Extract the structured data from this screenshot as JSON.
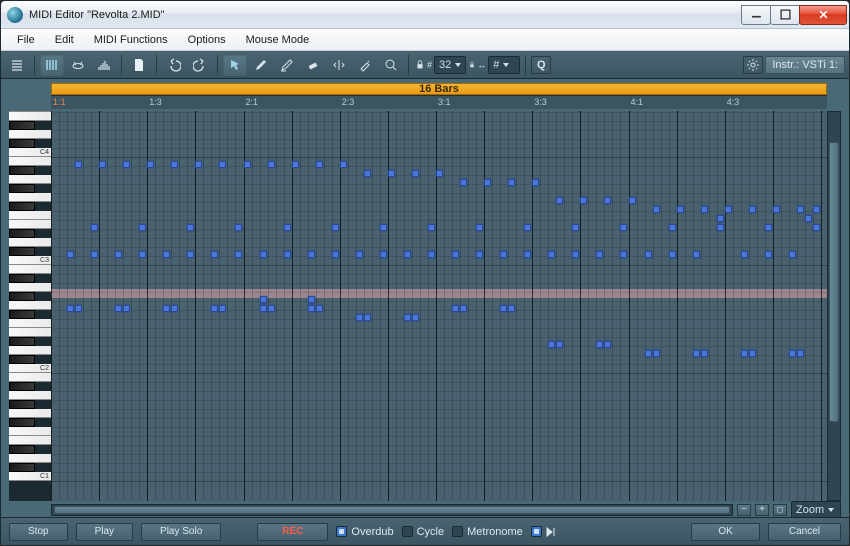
{
  "window": {
    "title": "MIDI Editor \"Revolta 2.MID\""
  },
  "menus": [
    "File",
    "Edit",
    "MIDI Functions",
    "Options",
    "Mouse Mode"
  ],
  "toolbar": {
    "snap_value": "32",
    "snap_len": "#",
    "instr_label": "Instr.: VSTi 1:"
  },
  "loop": {
    "label": "16 Bars"
  },
  "ruler": {
    "ticks": [
      "1:1",
      "1:3",
      "2:1",
      "2:3",
      "3:1",
      "3:3",
      "4:1",
      "4:3"
    ]
  },
  "keyboard": {
    "octave_labels": [
      "C1",
      "C2",
      "C3",
      "C4"
    ]
  },
  "footer": {
    "stop": "Stop",
    "play": "Play",
    "playsolo": "Play Solo",
    "rec": "REC",
    "overdub": "Overdub",
    "cycle": "Cycle",
    "metronome": "Metronome",
    "ok": "OK",
    "cancel": "Cancel"
  },
  "zoom": {
    "label": "Zoom"
  },
  "notes": [
    {
      "x": 2,
      "r": 10
    },
    {
      "x": 3,
      "r": 20
    },
    {
      "x": 5,
      "r": 10
    },
    {
      "x": 6,
      "r": 20
    },
    {
      "x": 8,
      "r": 10
    },
    {
      "x": 9,
      "r": 20
    },
    {
      "x": 11,
      "r": 10
    },
    {
      "x": 12,
      "r": 20
    },
    {
      "x": 14,
      "r": 10
    },
    {
      "x": 15,
      "r": 20
    },
    {
      "x": 17,
      "r": 10
    },
    {
      "x": 18,
      "r": 20
    },
    {
      "x": 20,
      "r": 10
    },
    {
      "x": 21,
      "r": 20
    },
    {
      "x": 23,
      "r": 10
    },
    {
      "x": 24,
      "r": 20
    },
    {
      "x": 26,
      "r": 10
    },
    {
      "x": 27,
      "r": 20
    },
    {
      "x": 29,
      "r": 10
    },
    {
      "x": 30,
      "r": 20
    },
    {
      "x": 32,
      "r": 10
    },
    {
      "x": 33,
      "r": 20
    },
    {
      "x": 35,
      "r": 10
    },
    {
      "x": 36,
      "r": 20
    },
    {
      "x": 38,
      "r": 10
    },
    {
      "x": 39,
      "r": 19
    },
    {
      "x": 41,
      "r": 10
    },
    {
      "x": 42,
      "r": 19
    },
    {
      "x": 44,
      "r": 10
    },
    {
      "x": 45,
      "r": 19
    },
    {
      "x": 47,
      "r": 10
    },
    {
      "x": 48,
      "r": 19
    },
    {
      "x": 50,
      "r": 10
    },
    {
      "x": 51,
      "r": 18
    },
    {
      "x": 53,
      "r": 10
    },
    {
      "x": 54,
      "r": 18
    },
    {
      "x": 56,
      "r": 10
    },
    {
      "x": 57,
      "r": 18
    },
    {
      "x": 59,
      "r": 10
    },
    {
      "x": 60,
      "r": 18
    },
    {
      "x": 62,
      "r": 10
    },
    {
      "x": 63,
      "r": 16
    },
    {
      "x": 65,
      "r": 10
    },
    {
      "x": 66,
      "r": 16
    },
    {
      "x": 68,
      "r": 10
    },
    {
      "x": 69,
      "r": 16
    },
    {
      "x": 71,
      "r": 10
    },
    {
      "x": 72,
      "r": 16
    },
    {
      "x": 74,
      "r": 10
    },
    {
      "x": 75,
      "r": 15
    },
    {
      "x": 77,
      "r": 10
    },
    {
      "x": 78,
      "r": 15
    },
    {
      "x": 80,
      "r": 10
    },
    {
      "x": 81,
      "r": 15
    },
    {
      "x": 83,
      "r": 14
    },
    {
      "x": 84,
      "r": 15
    },
    {
      "x": 86,
      "r": 10
    },
    {
      "x": 87,
      "r": 15
    },
    {
      "x": 89,
      "r": 10
    },
    {
      "x": 90,
      "r": 15
    },
    {
      "x": 92,
      "r": 10
    },
    {
      "x": 93,
      "r": 15
    },
    {
      "x": 94,
      "r": 14
    },
    {
      "x": 95,
      "r": 15
    },
    {
      "x": 2,
      "r": 4
    },
    {
      "x": 3,
      "r": 4
    },
    {
      "x": 8,
      "r": 4
    },
    {
      "x": 9,
      "r": 4
    },
    {
      "x": 14,
      "r": 4
    },
    {
      "x": 15,
      "r": 4
    },
    {
      "x": 20,
      "r": 4
    },
    {
      "x": 21,
      "r": 4
    },
    {
      "x": 26,
      "r": 4
    },
    {
      "x": 26,
      "r": 5
    },
    {
      "x": 27,
      "r": 4
    },
    {
      "x": 32,
      "r": 4
    },
    {
      "x": 32,
      "r": 5
    },
    {
      "x": 33,
      "r": 4
    },
    {
      "x": 38,
      "r": 3
    },
    {
      "x": 39,
      "r": 3
    },
    {
      "x": 44,
      "r": 3
    },
    {
      "x": 45,
      "r": 3
    },
    {
      "x": 50,
      "r": 4
    },
    {
      "x": 51,
      "r": 4
    },
    {
      "x": 56,
      "r": 4
    },
    {
      "x": 57,
      "r": 4
    },
    {
      "x": 62,
      "r": 0
    },
    {
      "x": 63,
      "r": 0
    },
    {
      "x": 68,
      "r": 0
    },
    {
      "x": 69,
      "r": 0
    },
    {
      "x": 74,
      "r": -1
    },
    {
      "x": 75,
      "r": -1
    },
    {
      "x": 80,
      "r": -1
    },
    {
      "x": 81,
      "r": -1
    },
    {
      "x": 86,
      "r": -1
    },
    {
      "x": 87,
      "r": -1
    },
    {
      "x": 92,
      "r": -1
    },
    {
      "x": 93,
      "r": -1
    },
    {
      "x": 5,
      "r": 13
    },
    {
      "x": 11,
      "r": 13
    },
    {
      "x": 17,
      "r": 13
    },
    {
      "x": 23,
      "r": 13
    },
    {
      "x": 29,
      "r": 13
    },
    {
      "x": 35,
      "r": 13
    },
    {
      "x": 41,
      "r": 13
    },
    {
      "x": 47,
      "r": 13
    },
    {
      "x": 53,
      "r": 13
    },
    {
      "x": 59,
      "r": 13
    },
    {
      "x": 65,
      "r": 13
    },
    {
      "x": 71,
      "r": 13
    },
    {
      "x": 77,
      "r": 13
    },
    {
      "x": 83,
      "r": 13
    },
    {
      "x": 89,
      "r": 13
    },
    {
      "x": 95,
      "r": 13
    }
  ]
}
